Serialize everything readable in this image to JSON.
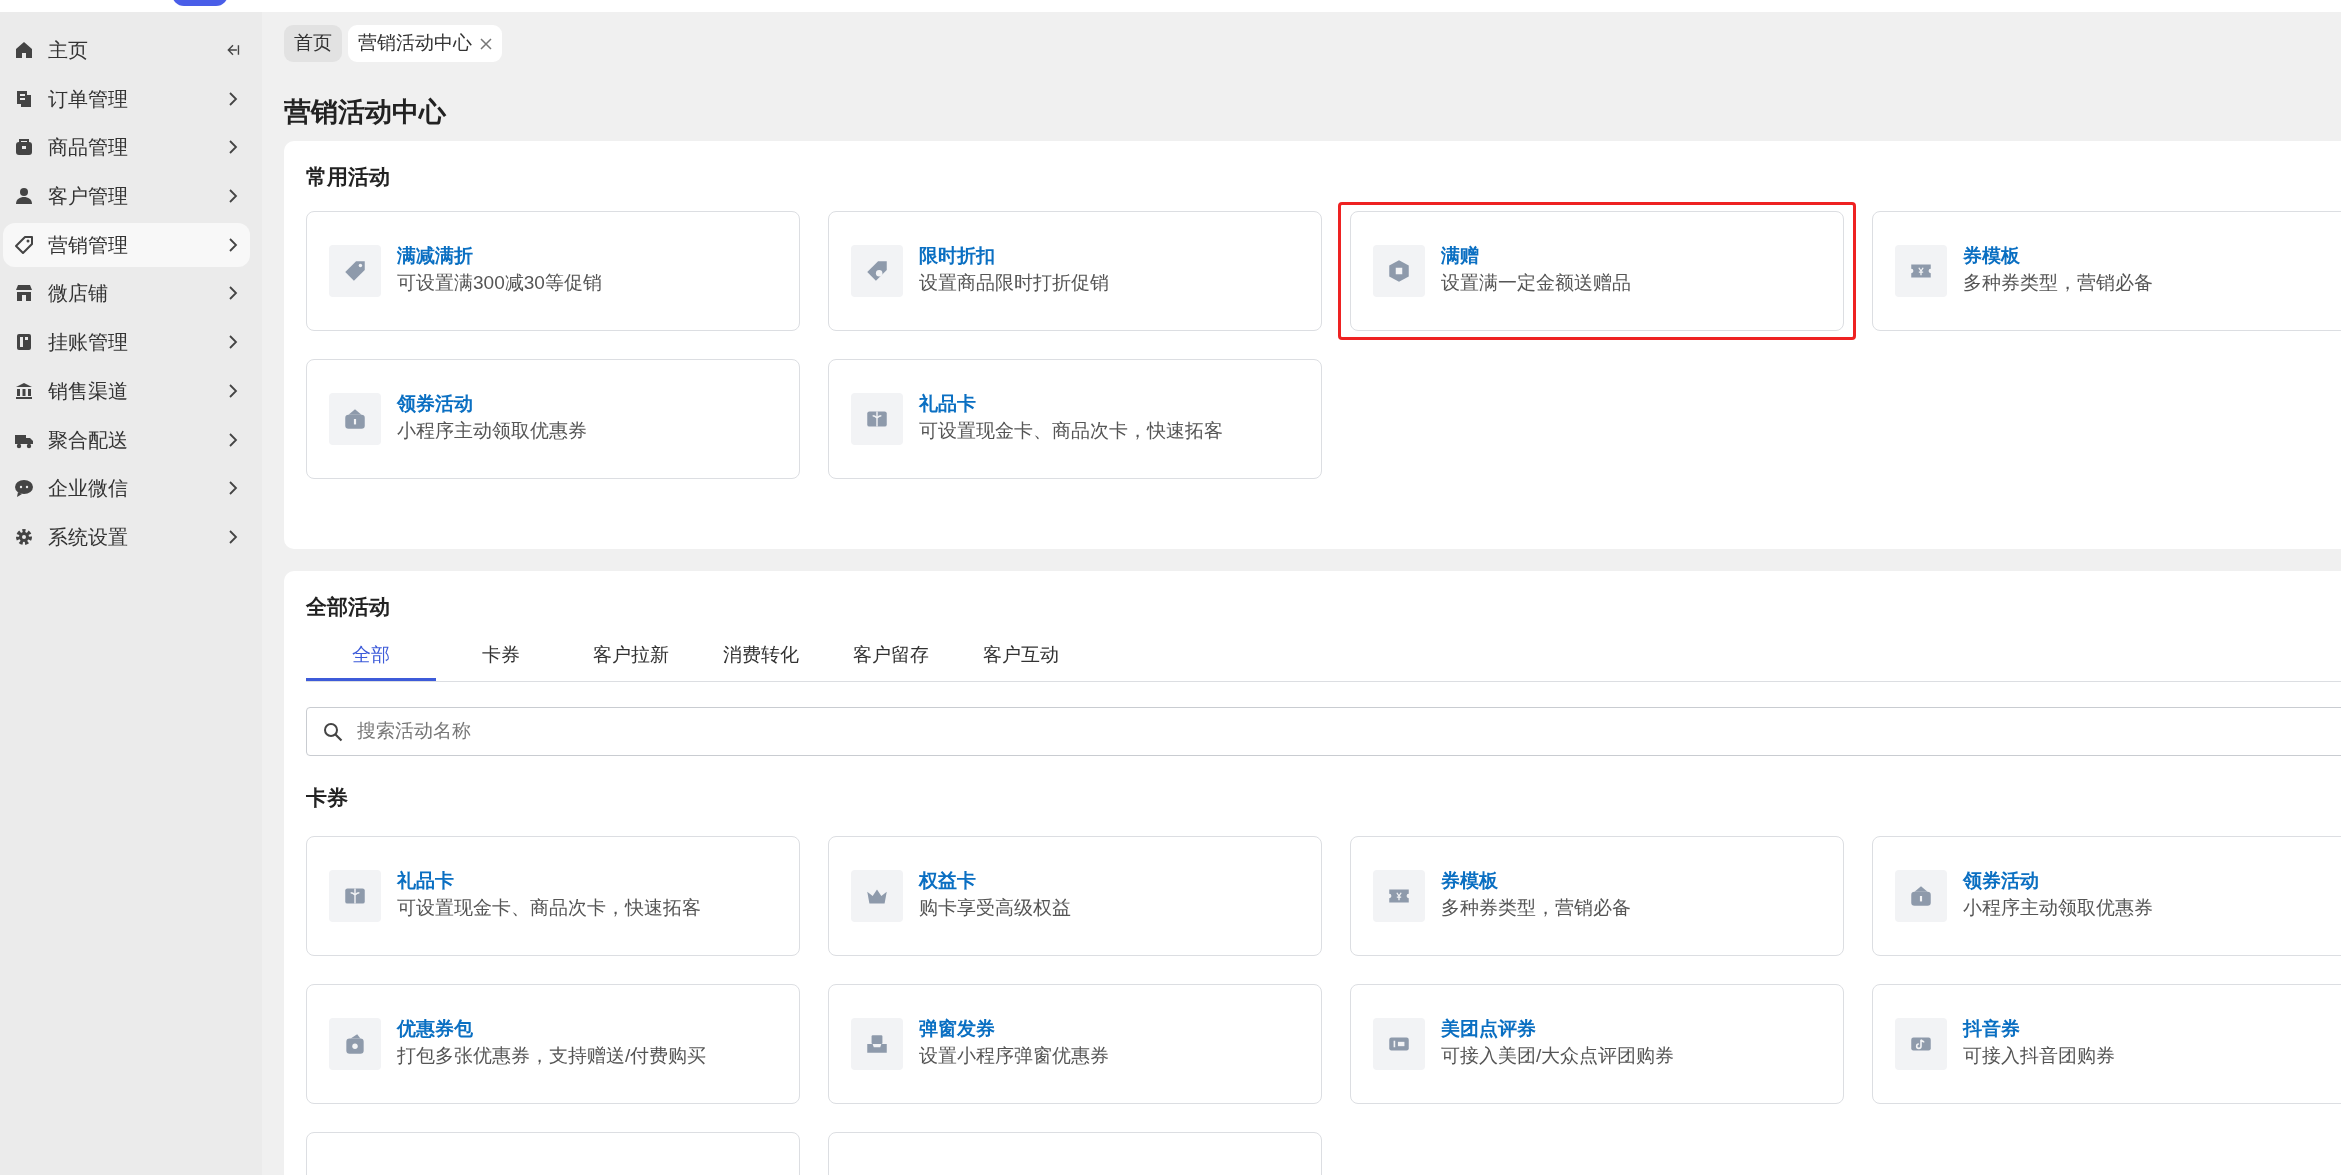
{
  "sidebar": {
    "items": [
      {
        "label": "主页",
        "selected": false,
        "kind": "home"
      },
      {
        "label": "订单管理",
        "selected": false,
        "kind": "menu"
      },
      {
        "label": "商品管理",
        "selected": false,
        "kind": "menu"
      },
      {
        "label": "客户管理",
        "selected": false,
        "kind": "menu"
      },
      {
        "label": "营销管理",
        "selected": true,
        "kind": "menu"
      },
      {
        "label": "微店铺",
        "selected": false,
        "kind": "menu"
      },
      {
        "label": "挂账管理",
        "selected": false,
        "kind": "menu"
      },
      {
        "label": "销售渠道",
        "selected": false,
        "kind": "menu"
      },
      {
        "label": "聚合配送",
        "selected": false,
        "kind": "menu"
      },
      {
        "label": "企业微信",
        "selected": false,
        "kind": "menu"
      },
      {
        "label": "系统设置",
        "selected": false,
        "kind": "menu"
      }
    ]
  },
  "page_tabs": [
    {
      "label": "首页",
      "selected": false,
      "closable": false
    },
    {
      "label": "营销活动中心",
      "selected": true,
      "closable": true
    }
  ],
  "page_title": "营销活动中心",
  "common": {
    "title": "常用活动",
    "items": [
      {
        "kind": "activity",
        "title": "满减满折",
        "desc": "可设置满300减30等促销",
        "highlighted": false
      },
      {
        "kind": "activity",
        "title": "限时折扣",
        "desc": "设置商品限时打折促销",
        "highlighted": false
      },
      {
        "kind": "activity",
        "title": "满赠",
        "desc": "设置满一定金额送赠品",
        "highlighted": true
      },
      {
        "kind": "activity",
        "title": "券模板",
        "desc": "多种券类型，营销必备",
        "highlighted": false
      },
      {
        "kind": "activity",
        "title": "领券活动",
        "desc": "小程序主动领取优惠券",
        "highlighted": false
      },
      {
        "kind": "activity",
        "title": "礼品卡",
        "desc": "可设置现金卡、商品次卡，快速拓客",
        "highlighted": false
      }
    ]
  },
  "all": {
    "title": "全部活动",
    "tabs": [
      {
        "label": "全部",
        "selected": true
      },
      {
        "label": "卡券",
        "selected": false
      },
      {
        "label": "客户拉新",
        "selected": false
      },
      {
        "label": "消费转化",
        "selected": false
      },
      {
        "label": "客户留存",
        "selected": false
      },
      {
        "label": "客户互动",
        "selected": false
      }
    ],
    "search": {
      "placeholder": "搜索活动名称"
    },
    "section_title": "卡券",
    "items": [
      {
        "kind": "activity",
        "title": "礼品卡",
        "desc": "可设置现金卡、商品次卡，快速拓客"
      },
      {
        "kind": "activity",
        "title": "权益卡",
        "desc": "购卡享受高级权益"
      },
      {
        "kind": "activity",
        "title": "券模板",
        "desc": "多种券类型，营销必备"
      },
      {
        "kind": "activity",
        "title": "领券活动",
        "desc": "小程序主动领取优惠券"
      },
      {
        "kind": "activity",
        "title": "优惠券包",
        "desc": "打包多张优惠券，支持赠送/付费购买"
      },
      {
        "kind": "activity",
        "title": "弹窗发券",
        "desc": "设置小程序弹窗优惠券"
      },
      {
        "kind": "activity",
        "title": "美团点评券",
        "desc": "可接入美团/大众点评团购券"
      },
      {
        "kind": "activity",
        "title": "抖音券",
        "desc": "可接入抖音团购券"
      },
      {
        "kind": "cut"
      },
      {
        "kind": "cut"
      }
    ]
  }
}
